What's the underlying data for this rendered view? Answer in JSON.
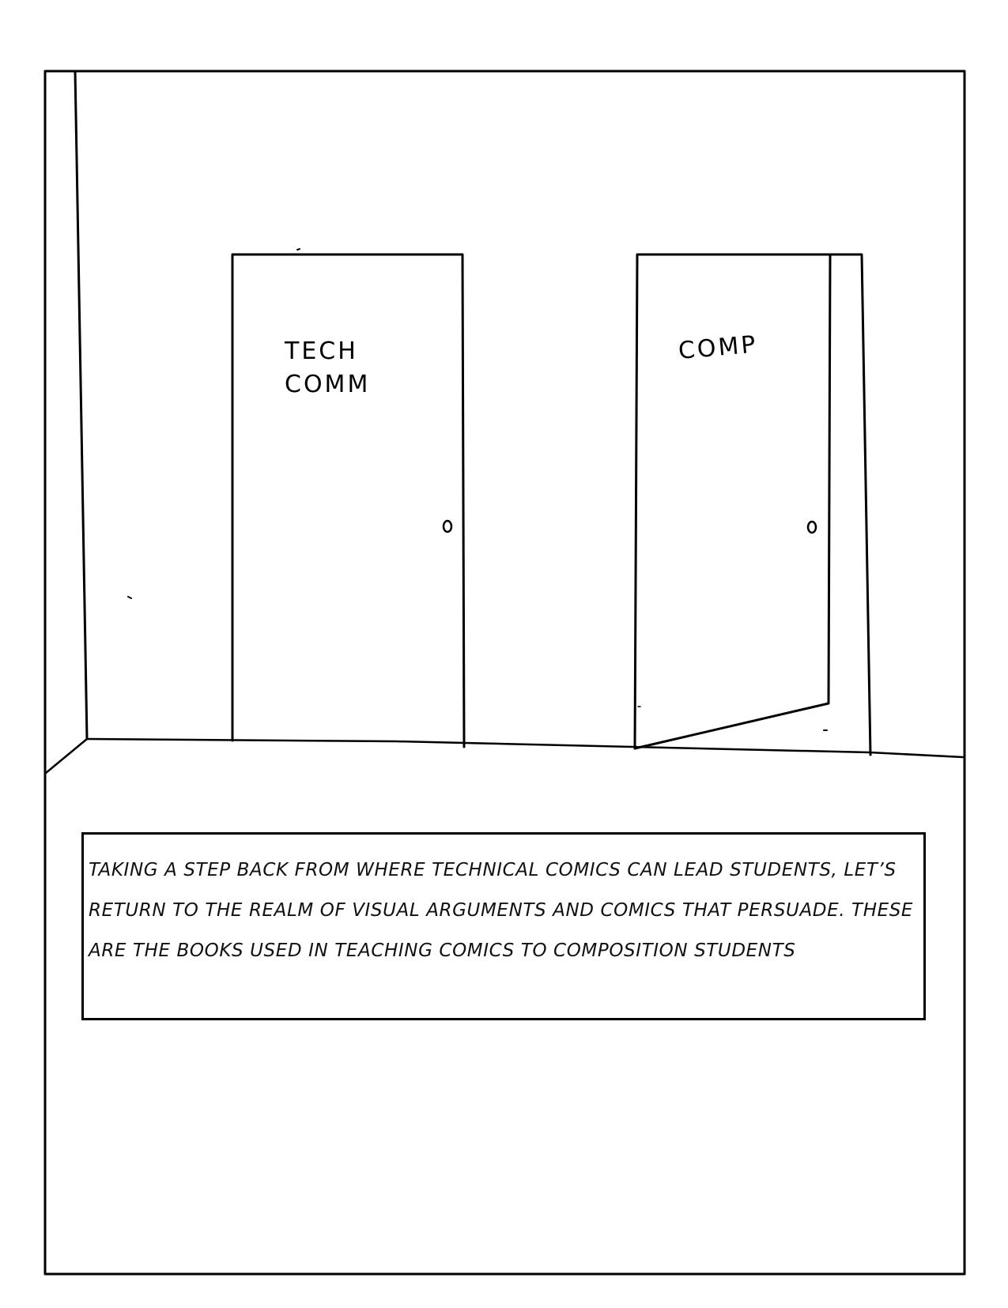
{
  "scene": {
    "doors": [
      {
        "label": "TECH\nCOMM",
        "state": "closed"
      },
      {
        "label": "COMP",
        "state": "ajar"
      }
    ]
  },
  "caption": {
    "text": "Taking a step back from where technical comics can lead students, let’s return to the realm of visual arguments and comics that persuade. These are the books used in teaching comics to composition students"
  },
  "colors": {
    "ink": "#000000",
    "paper": "#ffffff"
  }
}
